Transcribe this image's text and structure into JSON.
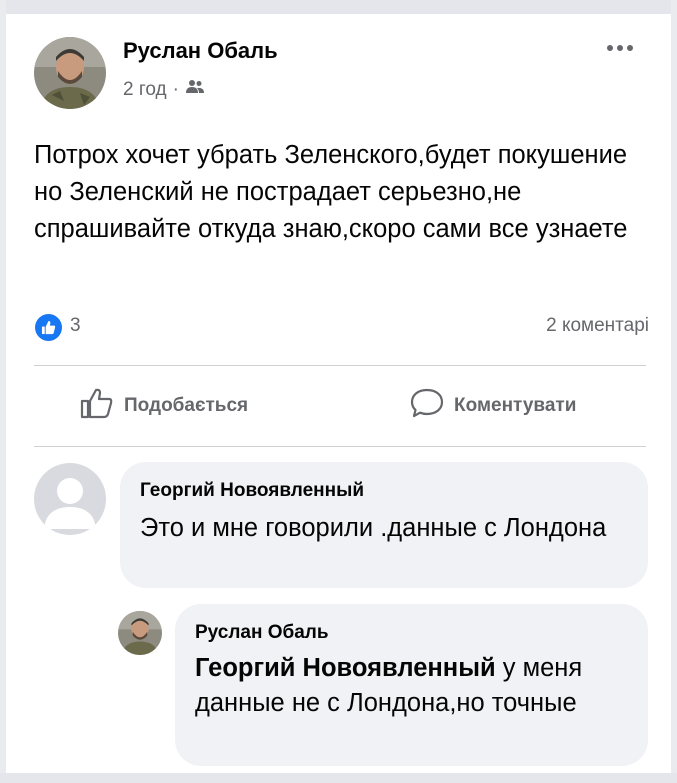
{
  "post": {
    "author": "Руслан Обаль",
    "time": "2 год",
    "separator": "·",
    "audience_icon": "friends-icon",
    "text": "Потрох хочет убрать Зеленского,будет покушение но Зеленский не пострадает серьезно,не спрашивайте откуда знаю,скоро сами все узнаете",
    "reactions_count": "3",
    "comments_count": "2 коментарі"
  },
  "actions": {
    "like_label": "Подобається",
    "comment_label": "Коментувати"
  },
  "comments": [
    {
      "author": "Георгий Новоявленный",
      "text": "Это и мне говорили .данные с Лондона"
    },
    {
      "author": "Руслан Обаль",
      "mention": "Георгий Новоявленный",
      "text": " у меня данные не с Лондона,но точные"
    }
  ],
  "colors": {
    "accent": "#1877f2",
    "secondary_text": "#65676b",
    "bubble": "#f0f2f5"
  }
}
